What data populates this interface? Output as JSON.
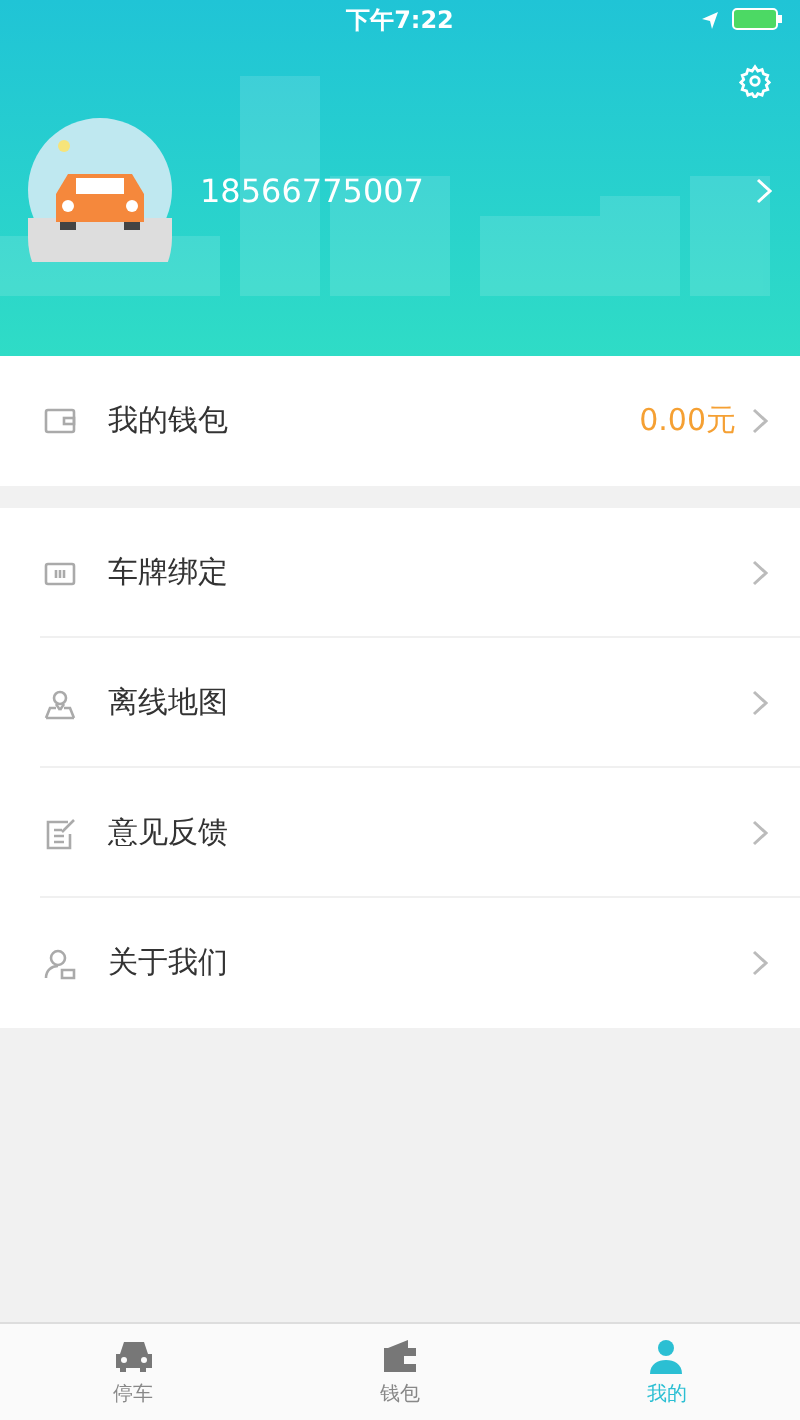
{
  "status_bar": {
    "time": "下午7:22"
  },
  "profile": {
    "phone": "18566775007"
  },
  "wallet": {
    "label": "我的钱包",
    "amount": "0.00元"
  },
  "menu": [
    {
      "kind": "plate",
      "label": "车牌绑定"
    },
    {
      "kind": "map",
      "label": "离线地图"
    },
    {
      "kind": "feedback",
      "label": "意见反馈"
    },
    {
      "kind": "about",
      "label": "关于我们"
    }
  ],
  "tabs": [
    {
      "kind": "car",
      "label": "停车",
      "selected": false
    },
    {
      "kind": "wallet",
      "label": "钱包",
      "selected": false
    },
    {
      "kind": "person",
      "label": "我的",
      "selected": true
    }
  ]
}
